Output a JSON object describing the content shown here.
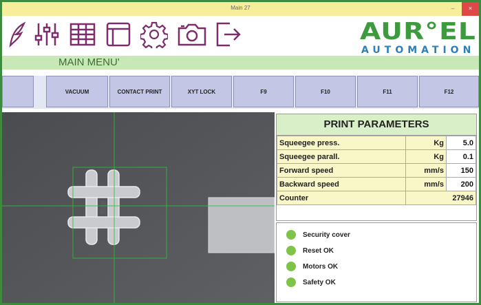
{
  "window": {
    "title": "Main 27",
    "minimize": "–",
    "close": "×"
  },
  "toolbar": {
    "icons": [
      "feather-icon",
      "sliders-icon",
      "grid-icon",
      "window-icon",
      "gear-icon",
      "camera-icon",
      "exit-icon"
    ],
    "accent_color": "#7b2d6b"
  },
  "logo": {
    "brand": "AUR°EL",
    "sub": "AUTOMATION",
    "brand_color": "#3e9a3e",
    "sub_color": "#2d7fb8"
  },
  "menu": {
    "title": "MAIN MENU'"
  },
  "function_keys": [
    "",
    "VACUUM",
    "CONTACT PRINT",
    "XYT LOCK",
    "F9",
    "F10",
    "F11",
    "F12"
  ],
  "print_parameters": {
    "title": "PRINT PARAMETERS",
    "rows": [
      {
        "name": "Squeegee press.",
        "unit": "Kg",
        "value": "5.0"
      },
      {
        "name": "Squeegee parall.",
        "unit": "Kg",
        "value": "0.1"
      },
      {
        "name": "Forward speed",
        "unit": "mm/s",
        "value": "150"
      },
      {
        "name": "Backward speed",
        "unit": "mm/s",
        "value": "200"
      }
    ],
    "counter_label": "Counter",
    "counter_value": "27946"
  },
  "status": {
    "items": [
      "Security cover",
      "Reset OK",
      "Motors OK",
      "Safety OK"
    ],
    "ok_color": "#7fc34a"
  }
}
